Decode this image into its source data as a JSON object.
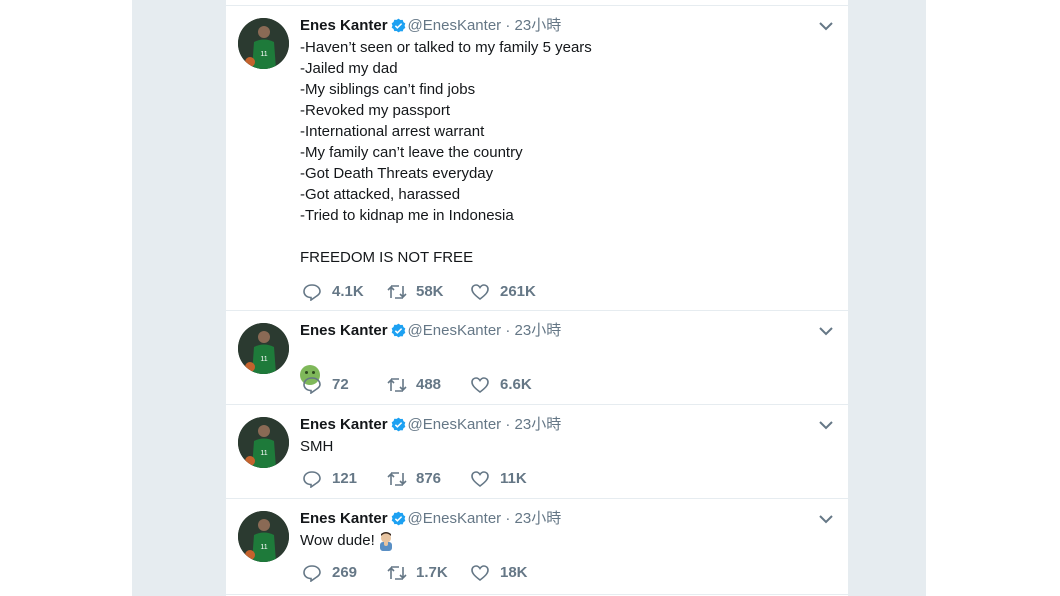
{
  "tweets": [
    {
      "name": "Enes Kanter",
      "handle": "@EnesKanter",
      "separator": "·",
      "time": "23小時",
      "text": "-Haven’t seen or talked to my family 5 years\n-Jailed my dad\n-My siblings can’t find jobs\n-Revoked my passport\n-International arrest warrant\n-My family can’t leave the country\n-Got Death Threats everyday\n-Got attacked, harassed\n-Tried to kidnap me in Indonesia\n\nFREEDOM IS NOT FREE",
      "replies": "4.1K",
      "retweets": "58K",
      "likes": "261K"
    },
    {
      "name": "Enes Kanter",
      "handle": "@EnesKanter",
      "separator": "·",
      "time": "23小時",
      "text": "",
      "emoji": "nauseated-face",
      "replies": "72",
      "retweets": "488",
      "likes": "6.6K"
    },
    {
      "name": "Enes Kanter",
      "handle": "@EnesKanter",
      "separator": "·",
      "time": "23小時",
      "text": "SMH",
      "replies": "121",
      "retweets": "876",
      "likes": "11K"
    },
    {
      "name": "Enes Kanter",
      "handle": "@EnesKanter",
      "separator": "·",
      "time": "23小時",
      "text": "Wow dude!",
      "emoji": "person-facepalming",
      "replies": "269",
      "retweets": "1.7K",
      "likes": "18K"
    }
  ],
  "colors": {
    "verified": "#1da1f2",
    "muted": "#657786",
    "border": "#e6ecf0",
    "jersey": "#1e7a3a"
  }
}
